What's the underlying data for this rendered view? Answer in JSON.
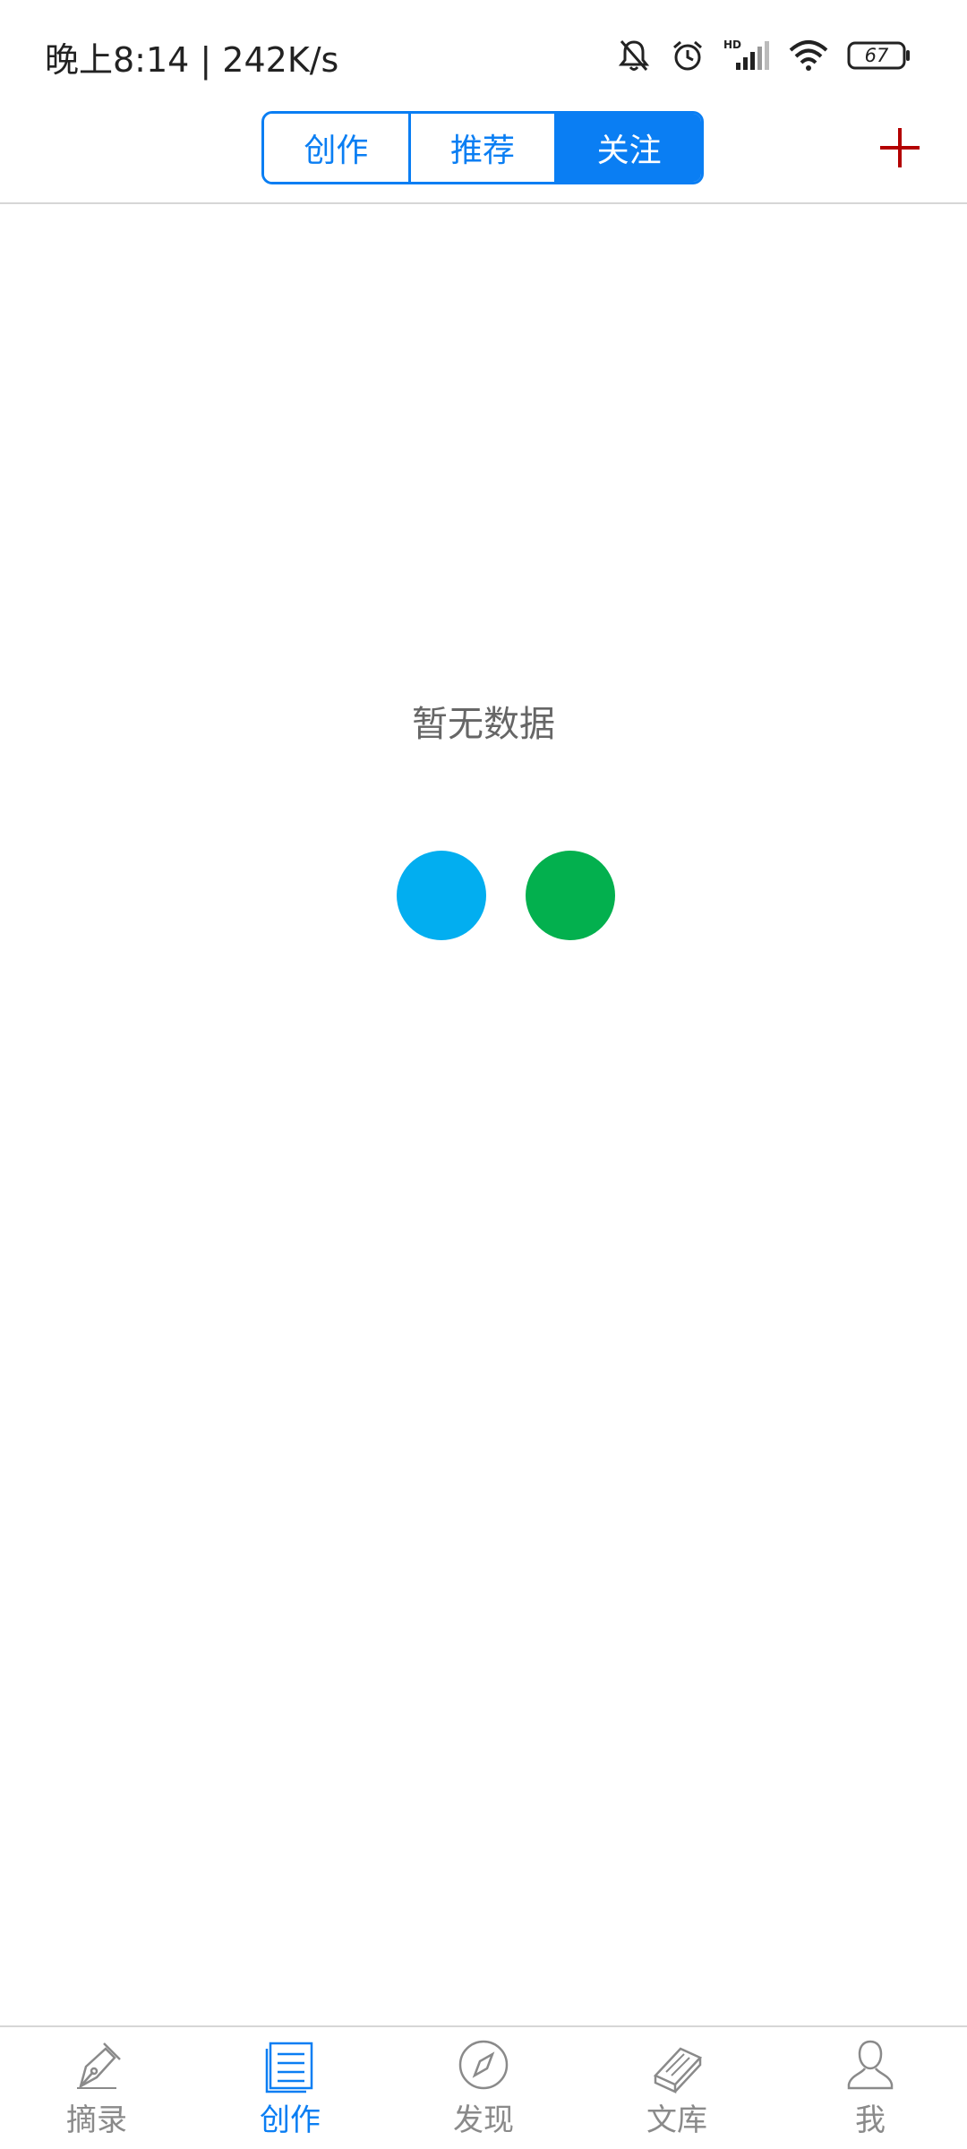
{
  "status_bar": {
    "time_speed": "晚上8:14 | 242K/s",
    "battery": "67",
    "icons": [
      "bell-muted-icon",
      "alarm-icon",
      "hd-signal-icon",
      "wifi-icon",
      "battery-icon"
    ]
  },
  "header": {
    "tabs": [
      {
        "label": "创作",
        "active": false
      },
      {
        "label": "推荐",
        "active": false
      },
      {
        "label": "关注",
        "active": true
      }
    ],
    "add_icon": "plus-icon",
    "accent_color": "#0a7ef3",
    "add_color": "#b30000"
  },
  "main": {
    "empty_text": "暂无数据",
    "loader_colors": [
      "#02aef0",
      "#03b04e"
    ]
  },
  "bottom_nav": {
    "items": [
      {
        "label": "摘录",
        "icon": "pen-nib-icon",
        "active": false
      },
      {
        "label": "创作",
        "icon": "document-icon",
        "active": true
      },
      {
        "label": "发现",
        "icon": "compass-icon",
        "active": false
      },
      {
        "label": "文库",
        "icon": "books-icon",
        "active": false
      },
      {
        "label": "我",
        "icon": "user-icon",
        "active": false
      }
    ]
  }
}
